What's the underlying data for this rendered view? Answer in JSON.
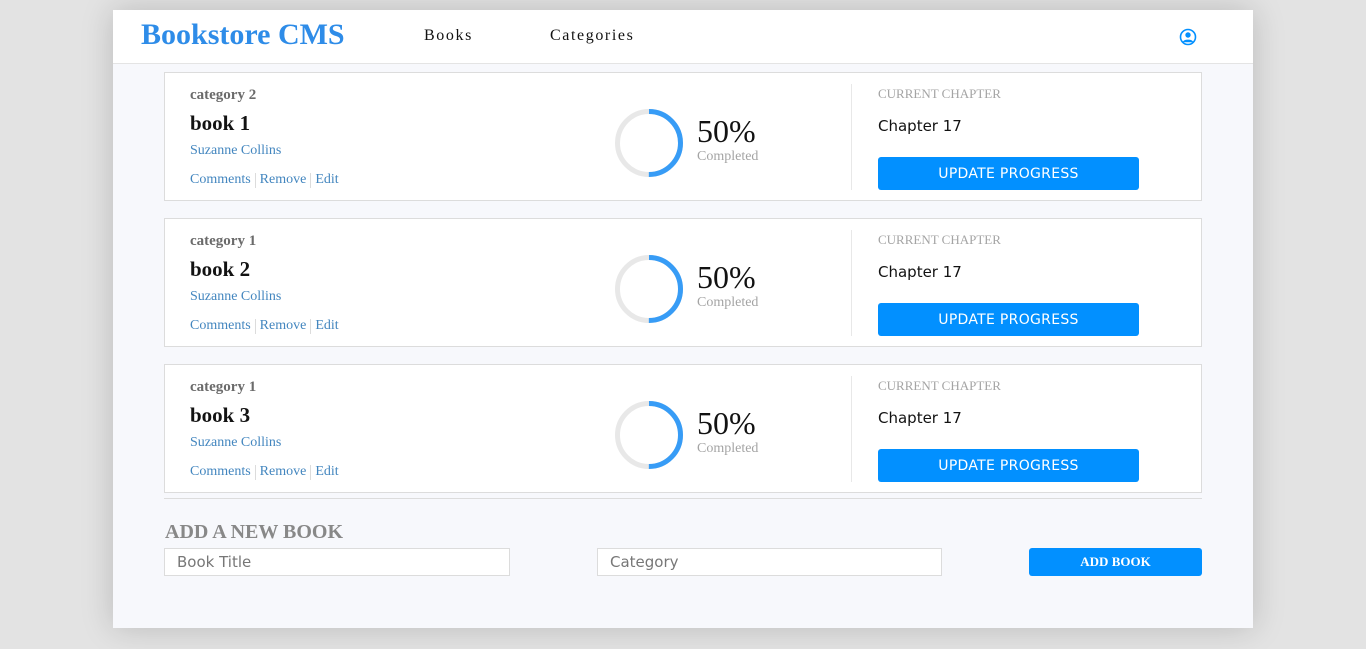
{
  "header": {
    "brand": "Bookstore CMS",
    "nav": [
      {
        "label": "Books"
      },
      {
        "label": "Categories"
      }
    ],
    "user_icon": "user-icon"
  },
  "books": [
    {
      "category": "category 2",
      "title": "book 1",
      "author": "Suzanne Collins",
      "actions": [
        "Comments",
        "Remove",
        "Edit"
      ],
      "percent": "50%",
      "progress_fraction": 0.5,
      "completed_label": "Completed",
      "chapter_label": "CURRENT CHAPTER",
      "chapter": "Chapter 17",
      "update_label": "UPDATE PROGRESS"
    },
    {
      "category": "category 1",
      "title": "book 2",
      "author": "Suzanne Collins",
      "actions": [
        "Comments",
        "Remove",
        "Edit"
      ],
      "percent": "50%",
      "progress_fraction": 0.5,
      "completed_label": "Completed",
      "chapter_label": "CURRENT CHAPTER",
      "chapter": "Chapter 17",
      "update_label": "UPDATE PROGRESS"
    },
    {
      "category": "category 1",
      "title": "book 3",
      "author": "Suzanne Collins",
      "actions": [
        "Comments",
        "Remove",
        "Edit"
      ],
      "percent": "50%",
      "progress_fraction": 0.5,
      "completed_label": "Completed",
      "chapter_label": "CURRENT CHAPTER",
      "chapter": "Chapter 17",
      "update_label": "UPDATE PROGRESS"
    }
  ],
  "form": {
    "title": "ADD A NEW BOOK",
    "title_placeholder": "Book Title",
    "title_value": "",
    "category_placeholder": "Category",
    "category_value": "",
    "submit_label": "ADD BOOK"
  },
  "colors": {
    "brand": "#2e8ce8",
    "primary_button": "#0290ff",
    "progress_arc": "#379cf6",
    "progress_track": "#e8e8e8",
    "link": "#4386bf"
  }
}
